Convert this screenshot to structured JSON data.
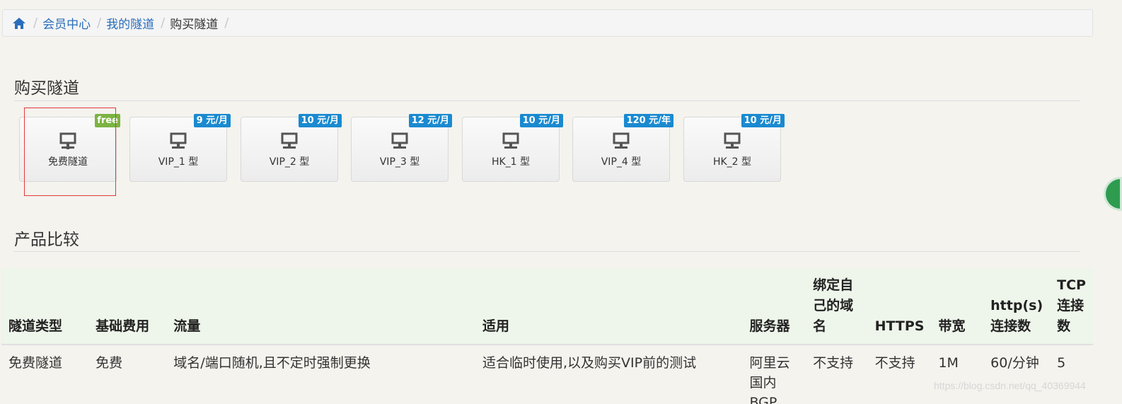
{
  "breadcrumb": {
    "items": [
      {
        "label": "会员中心"
      },
      {
        "label": "我的隧道"
      },
      {
        "label": "购买隧道"
      }
    ]
  },
  "sections": {
    "buy": "购买隧道",
    "compare": "产品比较"
  },
  "plans": [
    {
      "name": "免费隧道",
      "badge": "free"
    },
    {
      "name": "VIP_1 型",
      "badge": "9 元/月"
    },
    {
      "name": "VIP_2 型",
      "badge": "10 元/月"
    },
    {
      "name": "VIP_3 型",
      "badge": "12 元/月"
    },
    {
      "name": "HK_1 型",
      "badge": "10 元/月"
    },
    {
      "name": "VIP_4 型",
      "badge": "120 元/年"
    },
    {
      "name": "HK_2 型",
      "badge": "10 元/月"
    }
  ],
  "table": {
    "headers": [
      "隧道类型",
      "基础费用",
      "流量",
      "适用",
      "服务器",
      "绑定自己的域名",
      "HTTPS",
      "带宽",
      "http(s)连接数",
      "TCP连接数"
    ],
    "rows": [
      [
        "免费隧道",
        "免费",
        "域名/端口随机,且不定时强制更换",
        "适合临时使用,以及购买VIP前的测试",
        "阿里云国内BGP",
        "不支持",
        "不支持",
        "1M",
        "60/分钟",
        "5"
      ]
    ]
  },
  "watermark": "https://blog.csdn.net/qq_40369944",
  "colors": {
    "link": "#2a6ebb",
    "price_badge": "#1a8ad0",
    "free_badge": "#7cb342",
    "table_header_bg": "#eef5ea"
  },
  "icons": {
    "home": "home-icon",
    "tunnel": "network-icon"
  }
}
